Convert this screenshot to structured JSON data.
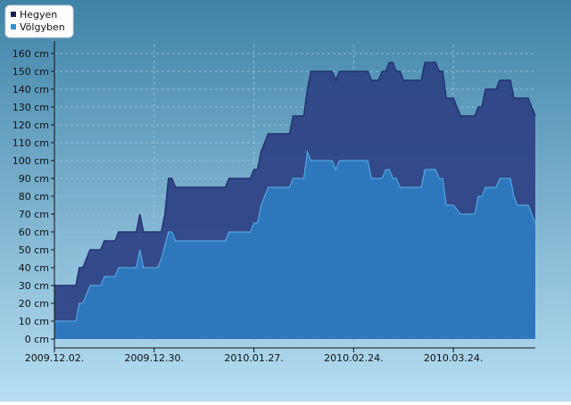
{
  "colors": {
    "background_top": "#3f83a8",
    "background_bottom": "#b7def2",
    "series_mountain": "#23336f",
    "series_mountain_fill": "#2f4386",
    "series_valley": "#2f77bc",
    "series_valley_line": "#5ab4e8",
    "grid": "#9cc6e0",
    "axis_text": "#111111",
    "legend_bg": "#ffffff",
    "legend_mountain_square": "#1a1f5a",
    "legend_valley_square": "#2f8fd6"
  },
  "chart_data": {
    "type": "area",
    "title": "",
    "xlabel": "",
    "ylabel": "",
    "ylim": [
      -5,
      165
    ],
    "xlim": [
      "2009-12-02",
      "2010-04-16"
    ],
    "y_ticks": [
      0,
      10,
      20,
      30,
      40,
      50,
      60,
      70,
      80,
      90,
      100,
      110,
      120,
      130,
      140,
      150,
      160
    ],
    "y_unit": "cm",
    "x_tick_labels": [
      {
        "date": "2009-12-02",
        "label": "2009.12.02."
      },
      {
        "date": "2009-12-30",
        "label": "2009.12.30."
      },
      {
        "date": "2010-01-27",
        "label": "2010.01.27."
      },
      {
        "date": "2010-02-24",
        "label": "2010.02.24."
      },
      {
        "date": "2010-03-24",
        "label": "2010.03.24."
      }
    ],
    "grid": true,
    "legend_position": "top-left",
    "series": [
      {
        "name": "Hegyen",
        "points": [
          [
            "2009-12-02",
            30
          ],
          [
            "2009-12-08",
            30
          ],
          [
            "2009-12-09",
            40
          ],
          [
            "2009-12-10",
            40
          ],
          [
            "2009-12-12",
            50
          ],
          [
            "2009-12-15",
            50
          ],
          [
            "2009-12-16",
            55
          ],
          [
            "2009-12-19",
            55
          ],
          [
            "2009-12-20",
            60
          ],
          [
            "2009-12-25",
            60
          ],
          [
            "2009-12-26",
            70
          ],
          [
            "2009-12-27",
            60
          ],
          [
            "2010-01-01",
            60
          ],
          [
            "2010-01-02",
            70
          ],
          [
            "2010-01-03",
            90
          ],
          [
            "2010-01-04",
            90
          ],
          [
            "2010-01-05",
            85
          ],
          [
            "2010-01-19",
            85
          ],
          [
            "2010-01-20",
            90
          ],
          [
            "2010-01-26",
            90
          ],
          [
            "2010-01-27",
            95
          ],
          [
            "2010-01-28",
            95
          ],
          [
            "2010-01-29",
            105
          ],
          [
            "2010-01-31",
            115
          ],
          [
            "2010-02-06",
            115
          ],
          [
            "2010-02-07",
            125
          ],
          [
            "2010-02-10",
            125
          ],
          [
            "2010-02-11",
            140
          ],
          [
            "2010-02-12",
            150
          ],
          [
            "2010-02-18",
            150
          ],
          [
            "2010-02-19",
            145
          ],
          [
            "2010-02-20",
            150
          ],
          [
            "2010-02-28",
            150
          ],
          [
            "2010-03-01",
            145
          ],
          [
            "2010-03-03",
            145
          ],
          [
            "2010-03-04",
            150
          ],
          [
            "2010-03-05",
            150
          ],
          [
            "2010-03-06",
            155
          ],
          [
            "2010-03-07",
            155
          ],
          [
            "2010-03-08",
            150
          ],
          [
            "2010-03-09",
            150
          ],
          [
            "2010-03-10",
            145
          ],
          [
            "2010-03-15",
            145
          ],
          [
            "2010-03-16",
            155
          ],
          [
            "2010-03-19",
            155
          ],
          [
            "2010-03-20",
            150
          ],
          [
            "2010-03-21",
            150
          ],
          [
            "2010-03-22",
            135
          ],
          [
            "2010-03-24",
            135
          ],
          [
            "2010-03-26",
            125
          ],
          [
            "2010-03-30",
            125
          ],
          [
            "2010-03-31",
            130
          ],
          [
            "2010-04-01",
            130
          ],
          [
            "2010-04-02",
            140
          ],
          [
            "2010-04-05",
            140
          ],
          [
            "2010-04-06",
            145
          ],
          [
            "2010-04-09",
            145
          ],
          [
            "2010-04-10",
            135
          ],
          [
            "2010-04-14",
            135
          ],
          [
            "2010-04-16",
            125
          ]
        ]
      },
      {
        "name": "Völgyben",
        "points": [
          [
            "2009-12-02",
            10
          ],
          [
            "2009-12-08",
            10
          ],
          [
            "2009-12-09",
            20
          ],
          [
            "2009-12-10",
            20
          ],
          [
            "2009-12-12",
            30
          ],
          [
            "2009-12-15",
            30
          ],
          [
            "2009-12-16",
            35
          ],
          [
            "2009-12-19",
            35
          ],
          [
            "2009-12-20",
            40
          ],
          [
            "2009-12-25",
            40
          ],
          [
            "2009-12-26",
            50
          ],
          [
            "2009-12-27",
            40
          ],
          [
            "2009-12-31",
            40
          ],
          [
            "2010-01-01",
            45
          ],
          [
            "2010-01-03",
            60
          ],
          [
            "2010-01-04",
            60
          ],
          [
            "2010-01-05",
            55
          ],
          [
            "2010-01-19",
            55
          ],
          [
            "2010-01-20",
            60
          ],
          [
            "2010-01-26",
            60
          ],
          [
            "2010-01-27",
            65
          ],
          [
            "2010-01-28",
            65
          ],
          [
            "2010-01-29",
            75
          ],
          [
            "2010-01-31",
            85
          ],
          [
            "2010-02-06",
            85
          ],
          [
            "2010-02-07",
            90
          ],
          [
            "2010-02-10",
            90
          ],
          [
            "2010-02-11",
            105
          ],
          [
            "2010-02-12",
            100
          ],
          [
            "2010-02-18",
            100
          ],
          [
            "2010-02-19",
            95
          ],
          [
            "2010-02-20",
            100
          ],
          [
            "2010-02-28",
            100
          ],
          [
            "2010-03-01",
            90
          ],
          [
            "2010-03-03",
            90
          ],
          [
            "2010-03-04",
            90
          ],
          [
            "2010-03-05",
            95
          ],
          [
            "2010-03-06",
            95
          ],
          [
            "2010-03-07",
            90
          ],
          [
            "2010-03-08",
            90
          ],
          [
            "2010-03-09",
            85
          ],
          [
            "2010-03-15",
            85
          ],
          [
            "2010-03-16",
            95
          ],
          [
            "2010-03-19",
            95
          ],
          [
            "2010-03-20",
            90
          ],
          [
            "2010-03-21",
            90
          ],
          [
            "2010-03-22",
            75
          ],
          [
            "2010-03-24",
            75
          ],
          [
            "2010-03-26",
            70
          ],
          [
            "2010-03-30",
            70
          ],
          [
            "2010-03-31",
            80
          ],
          [
            "2010-04-01",
            80
          ],
          [
            "2010-04-02",
            85
          ],
          [
            "2010-04-05",
            85
          ],
          [
            "2010-04-06",
            90
          ],
          [
            "2010-04-09",
            90
          ],
          [
            "2010-04-10",
            80
          ],
          [
            "2010-04-11",
            75
          ],
          [
            "2010-04-14",
            75
          ],
          [
            "2010-04-16",
            65
          ]
        ]
      }
    ]
  }
}
